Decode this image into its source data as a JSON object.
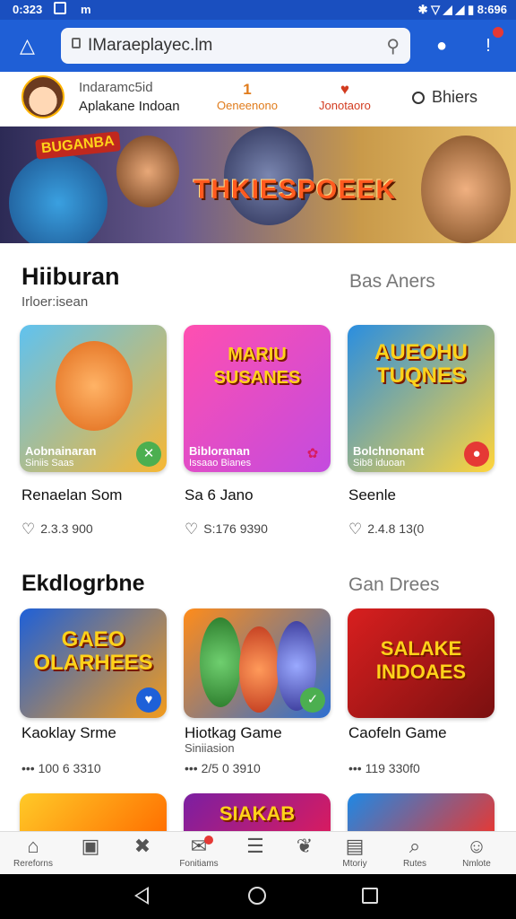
{
  "status": {
    "time": "0:323",
    "notif": "m",
    "right": "✱ ▽ ◢ ◢ ▮ 8:696"
  },
  "browser": {
    "url": "IMaraeplayec.lm"
  },
  "profile": {
    "name": "Indaramc5id",
    "subtitle": "Aplakane Indoan",
    "stats": [
      {
        "num": "1",
        "label": "Oeneenono"
      },
      {
        "num": "♥",
        "label": "Jonotaoro"
      }
    ],
    "search_label": "Bhiers"
  },
  "banner": {
    "title": "THKIESPOEEK",
    "badge": "BUGANBA"
  },
  "section1": {
    "title": "Hiiburan",
    "subtitle": "Irloer:isean",
    "right": "Bas Aners",
    "cards": [
      {
        "art": "",
        "cap": "Aobnainaran",
        "cap2": "Siniis Saas",
        "badge": "✕",
        "name": "Renaelan Som",
        "meta": "2.3.3 900",
        "c1": "#5fc2f0",
        "c2": "#f7b733"
      },
      {
        "art": "MARIU SUSANES",
        "cap": "Bibloranan",
        "cap2": "Issaao Bianes",
        "badge": "✿",
        "name": "Sa 6 Jano",
        "meta": "S:176 9390",
        "c1": "#ff4fb0",
        "c2": "#c34bdf"
      },
      {
        "art": "AUEOHU TUQNES",
        "cap": "Bolchnonant",
        "cap2": "Sib8 iduoan",
        "badge": "●",
        "name": "Seenle",
        "meta": "2.4.8 13(0",
        "c1": "#2a8ee0",
        "c2": "#ffd43b"
      }
    ]
  },
  "section2": {
    "title": "Ekdlogrbne",
    "right": "Gan Drees",
    "cards": [
      {
        "art": "GAEO OLARHEES",
        "badge": "♥",
        "name": "Kaoklay Srme",
        "sub": "",
        "meta": "••• 100 6 3310",
        "c1": "#1e60d8",
        "c2": "#f29b1d"
      },
      {
        "art": "",
        "badge": "✓",
        "name": "Hiotkag Game",
        "sub": "Siniiasion",
        "meta": "••• 2/5 0 3910",
        "c1": "#ff8c1a",
        "c2": "#2d6fd1"
      },
      {
        "art": "SALAKE INDOAES",
        "badge": "",
        "name": "Caofeln Game",
        "sub": "",
        "meta": "••• 119 330f0",
        "c1": "#d81f1f",
        "c2": "#7a1010"
      }
    ]
  },
  "section3": {
    "cards": [
      {
        "art": "",
        "c1": "#ffca28",
        "c2": "#ff6f00"
      },
      {
        "art": "SIAKAB",
        "c1": "#7b1fa2",
        "c2": "#d81b60"
      },
      {
        "art": "",
        "c1": "#1e88e5",
        "c2": "#e53935"
      }
    ]
  },
  "bottomnav": [
    {
      "icon": "⌂",
      "label": "Rereforns"
    },
    {
      "icon": "▣",
      "label": ""
    },
    {
      "icon": "✖",
      "label": ""
    },
    {
      "icon": "✉",
      "label": "Fonitiams"
    },
    {
      "icon": "☰",
      "label": ""
    },
    {
      "icon": "❦",
      "label": ""
    },
    {
      "icon": "▤",
      "label": "Mtoriy"
    },
    {
      "icon": "⌕",
      "label": "Rutes"
    },
    {
      "icon": "☺",
      "label": "Nmlote"
    }
  ],
  "colors": {
    "toolbar": "#1f5fd6",
    "status": "#1a4fbf",
    "accent": "#e07b1b"
  }
}
